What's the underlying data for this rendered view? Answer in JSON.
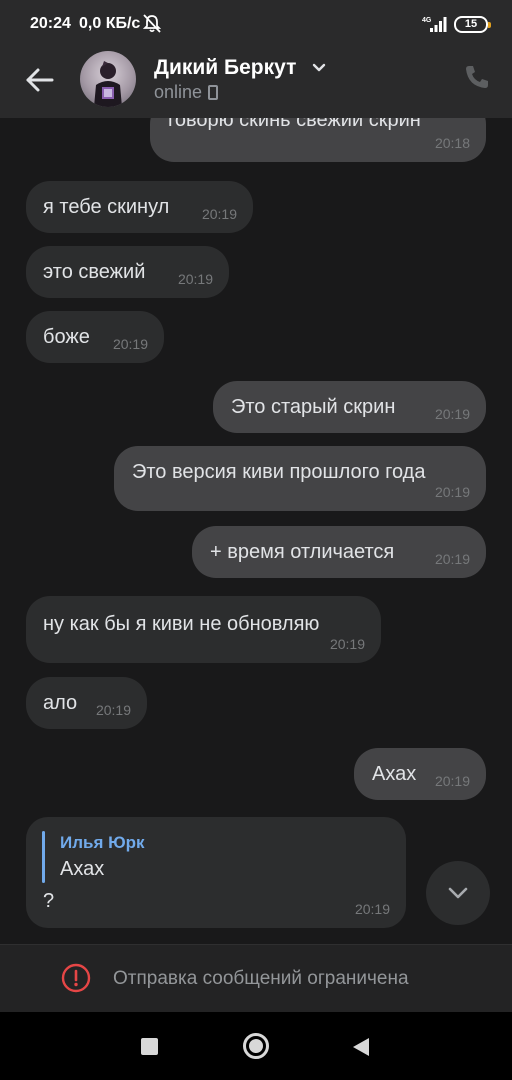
{
  "status_bar": {
    "time": "20:24",
    "speed": "0,0 КБ/с",
    "network": "4G",
    "battery": "15"
  },
  "header": {
    "contact_name": "Дикий Беркут",
    "status": "online"
  },
  "messages": [
    {
      "direction": "out",
      "text": "говорю скинь свежий скрин",
      "time": "20:18"
    },
    {
      "direction": "in",
      "text": "я тебе скинул",
      "time": "20:19"
    },
    {
      "direction": "in",
      "text": "это свежий",
      "time": "20:19"
    },
    {
      "direction": "in",
      "text": "боже",
      "time": "20:19"
    },
    {
      "direction": "out",
      "text": "Это старый скрин",
      "time": "20:19"
    },
    {
      "direction": "out",
      "text": "Это версия киви прошлого года",
      "time": "20:19"
    },
    {
      "direction": "out",
      "text": "+ время отличается",
      "time": "20:19"
    },
    {
      "direction": "in",
      "text": "ну как бы я киви не обновляю",
      "time": "20:19"
    },
    {
      "direction": "in",
      "text": "ало",
      "time": "20:19"
    },
    {
      "direction": "out",
      "text": "Ахах",
      "time": "20:19"
    },
    {
      "direction": "in",
      "reply_author": "Илья Юрк",
      "reply_text": "Ахах",
      "text": "?",
      "time": "20:19"
    }
  ],
  "restriction": {
    "text": "Отправка сообщений ограничена"
  },
  "colors": {
    "background": "#19191a",
    "incoming_bubble": "#2c2d2e",
    "outgoing_bubble": "#444446",
    "accent": "#71aaeb",
    "warning": "#e64646"
  },
  "icons": {
    "back": "arrow-left-icon",
    "call": "phone-icon",
    "scroll": "chevron-down-icon",
    "warning": "exclamation-circle-icon"
  }
}
